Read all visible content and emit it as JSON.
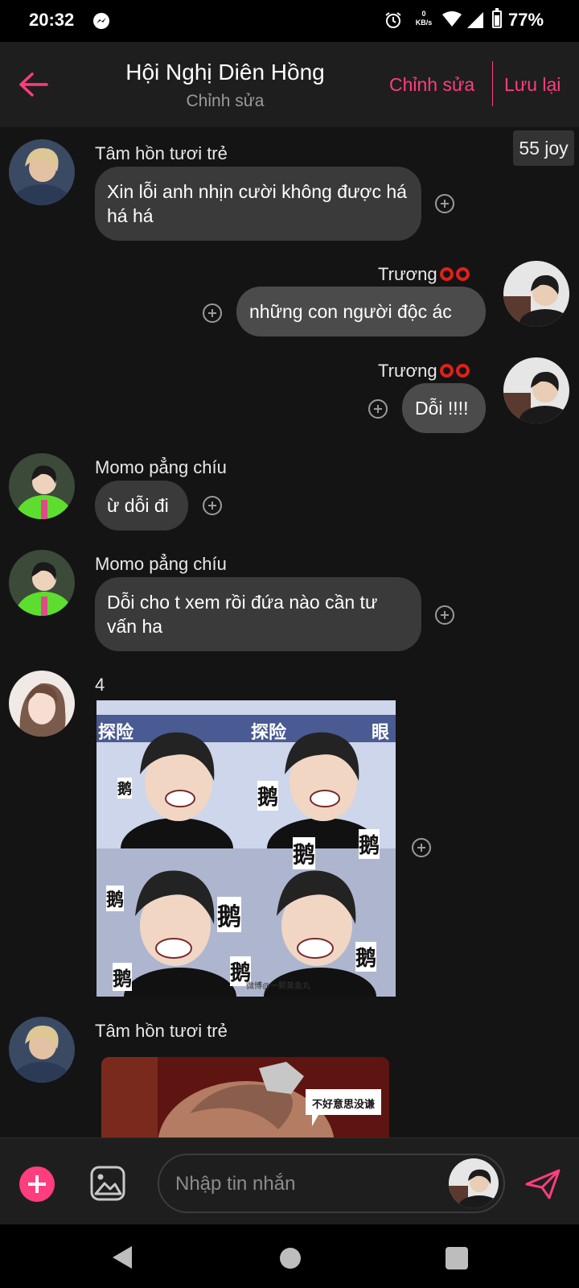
{
  "status_bar": {
    "time": "20:32",
    "net_speed_value": "0",
    "net_speed_unit": "KB/s",
    "battery": "77%"
  },
  "header": {
    "title": "Hội Nghị Diên Hồng",
    "subtitle": "Chỉnh sửa",
    "edit_label": "Chỉnh sửa",
    "save_label": "Lưu lại"
  },
  "badge": {
    "label": "55 joy"
  },
  "messages": [
    {
      "sender": "Tâm hồn tươi trẻ",
      "text": "Xin lỗi anh nhịn cười không được há há há"
    },
    {
      "sender": "Trương",
      "text": "những con người độc ác"
    },
    {
      "sender": "Trương",
      "text": "Dỗi !!!!"
    },
    {
      "sender": "Momo pẳng chíu",
      "text": "ừ dỗi đi"
    },
    {
      "sender": "Momo pẳng chíu",
      "text": "Dỗi cho t xem rồi đứa nào cần tư vấn ha"
    },
    {
      "sender": "4",
      "image_caption": "微博@一颗黄鱼丸"
    },
    {
      "sender": "Tâm hồn tươi trẻ",
      "image_sign": "不好意思没谦"
    }
  ],
  "sticker_glyph": "鹅",
  "sticker_banner": "探险",
  "sticker_banner2": "眼",
  "composer": {
    "placeholder": "Nhập tin nhắn"
  },
  "colors": {
    "accent": "#ff3d7f",
    "background": "#141414",
    "bubble": "#3a3a3a"
  }
}
